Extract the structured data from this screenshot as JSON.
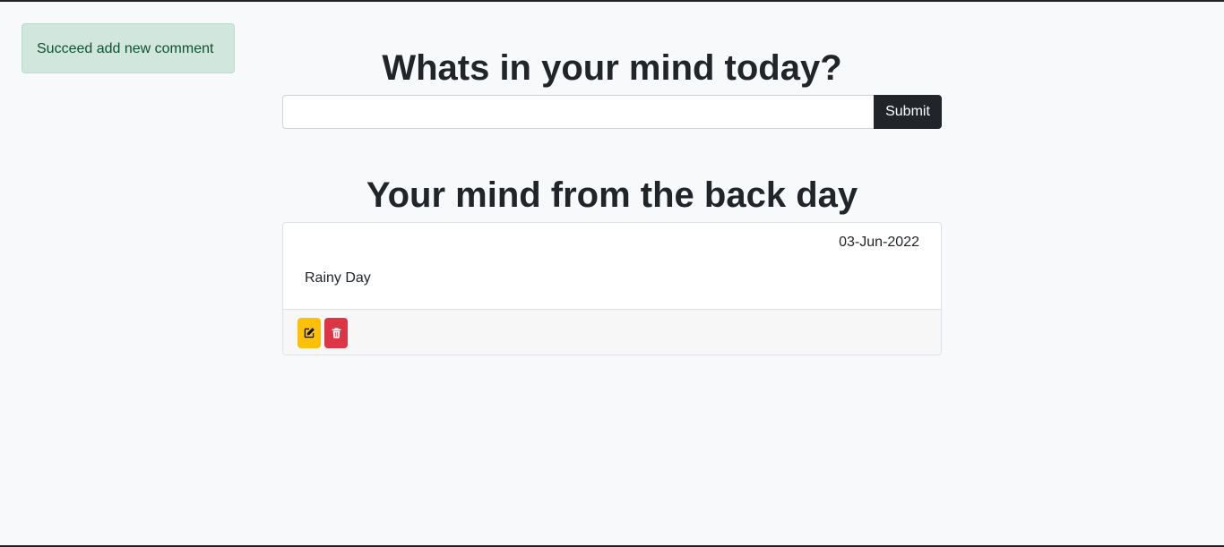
{
  "toast": {
    "message": "Succeed add new comment"
  },
  "composer": {
    "heading": "Whats in your mind today?",
    "input_value": "",
    "input_placeholder": "",
    "submit_label": "Submit"
  },
  "history": {
    "heading": "Your mind from the back day",
    "items": [
      {
        "date": "03-Jun-2022",
        "text": "Rainy Day",
        "edit_icon": "edit-icon",
        "delete_icon": "trash-icon"
      }
    ]
  },
  "colors": {
    "background": "#f8f9fa",
    "toast_bg": "#d1e7dd",
    "toast_text": "#0f5132",
    "submit_bg": "#212529",
    "edit_bg": "#ffc107",
    "delete_bg": "#dc3545"
  }
}
